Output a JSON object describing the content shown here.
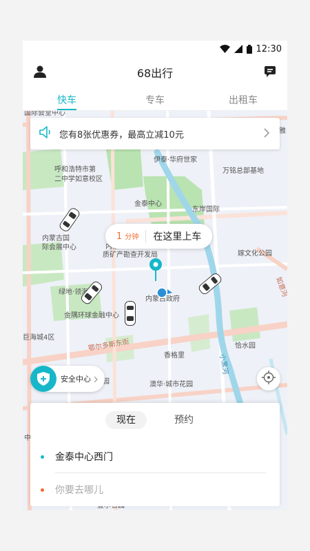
{
  "status": {
    "time": "12:30"
  },
  "header": {
    "title": "68出行"
  },
  "tabs": [
    {
      "label": "快车",
      "active": true
    },
    {
      "label": "专车",
      "active": false
    },
    {
      "label": "出租车",
      "active": false
    }
  ],
  "promo": {
    "text": "您有8张优惠券，最高立减10元"
  },
  "map": {
    "labels": [
      "国际会堂中心",
      "呼和浩特市第",
      "二中学如意校区",
      "伊泰·华府世家",
      "万铭总部基地",
      "金泰中心",
      "东岸国际",
      "内蒙古国",
      "际会展中心",
      "质矿产勘查开发局",
      "内蒙古政府",
      "金隅环球金融中心",
      "绿地·领海",
      "巨海城4区",
      "鄂尔多斯东街",
      "香格里",
      "恰水园",
      "澳华·城市花园",
      "嫁文化公园",
      "小黑河",
      "花园",
      "雅",
      "壹尔名园",
      "中",
      "如意河",
      "内蒙"
    ]
  },
  "bubble": {
    "minutes": "1",
    "unit": "分钟",
    "text": "在这里上车"
  },
  "safety": {
    "label": "安全中心"
  },
  "trip": {
    "modes": [
      {
        "label": "现在",
        "selected": true
      },
      {
        "label": "预约",
        "selected": false
      }
    ],
    "from": "金泰中心西门",
    "to_placeholder": "你要去哪儿"
  },
  "colors": {
    "accent": "#17b7c9",
    "orange": "#f26b2d",
    "river": "#9fd6ea",
    "park": "#b9e3b1",
    "road": "#f8d2c6"
  }
}
